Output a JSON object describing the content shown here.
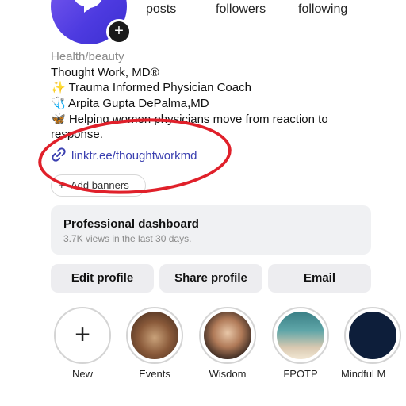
{
  "header": {
    "stats": [
      {
        "label": "posts"
      },
      {
        "label": "followers"
      },
      {
        "label": "following"
      }
    ]
  },
  "profile": {
    "category": "Health/beauty",
    "name": "Thought Work, MD®",
    "bio_line_1": "✨ Trauma Informed Physician Coach",
    "bio_line_2": "🩺 Arpita Gupta DePalma,MD",
    "bio_line_3": "🦋 Helping women physicians move from reaction to",
    "bio_line_4": "response.",
    "link": "linktr.ee/thoughtworkmd",
    "add_banners_label": "Add banners"
  },
  "dashboard": {
    "title": "Professional dashboard",
    "subtitle": "3.7K views in the last 30 days."
  },
  "actions": {
    "edit_profile": "Edit profile",
    "share_profile": "Share profile",
    "email": "Email"
  },
  "highlights": [
    {
      "label": "New",
      "icon": "plus-icon"
    },
    {
      "label": "Events"
    },
    {
      "label": "Wisdom"
    },
    {
      "label": "FPOTP"
    },
    {
      "label": "Mindful M"
    }
  ],
  "colors": {
    "avatar": "#5a45e6",
    "link": "#3a3fb0",
    "annotation_oval": "#e0202a",
    "dashboard_bg": "#f0f1f3",
    "button_bg": "#ededf0"
  }
}
